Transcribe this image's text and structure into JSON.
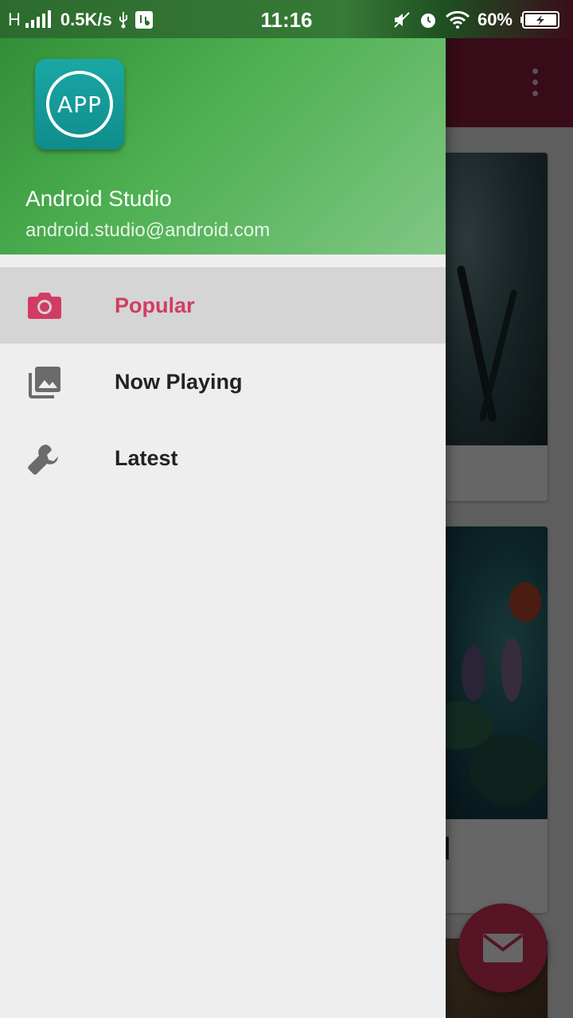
{
  "status_bar": {
    "network_type": "H",
    "speed": "0.5K/s",
    "time": "11:16",
    "battery": "60%"
  },
  "drawer": {
    "header": {
      "app_icon_text": "APP",
      "user_name": "Android Studio",
      "user_email": "android.studio@android.com"
    },
    "items": [
      {
        "label": "Popular",
        "icon": "camera-icon",
        "selected": true
      },
      {
        "label": "Now Playing",
        "icon": "photo-library-icon",
        "selected": false
      },
      {
        "label": "Latest",
        "icon": "wrench-icon",
        "selected": false
      }
    ]
  },
  "background": {
    "card2_caption": "ad",
    "fab_icon": "mail-icon"
  },
  "colors": {
    "accent": "#d23c63",
    "header_green": "#4caf50",
    "toolbar": "#8a1c3c"
  }
}
